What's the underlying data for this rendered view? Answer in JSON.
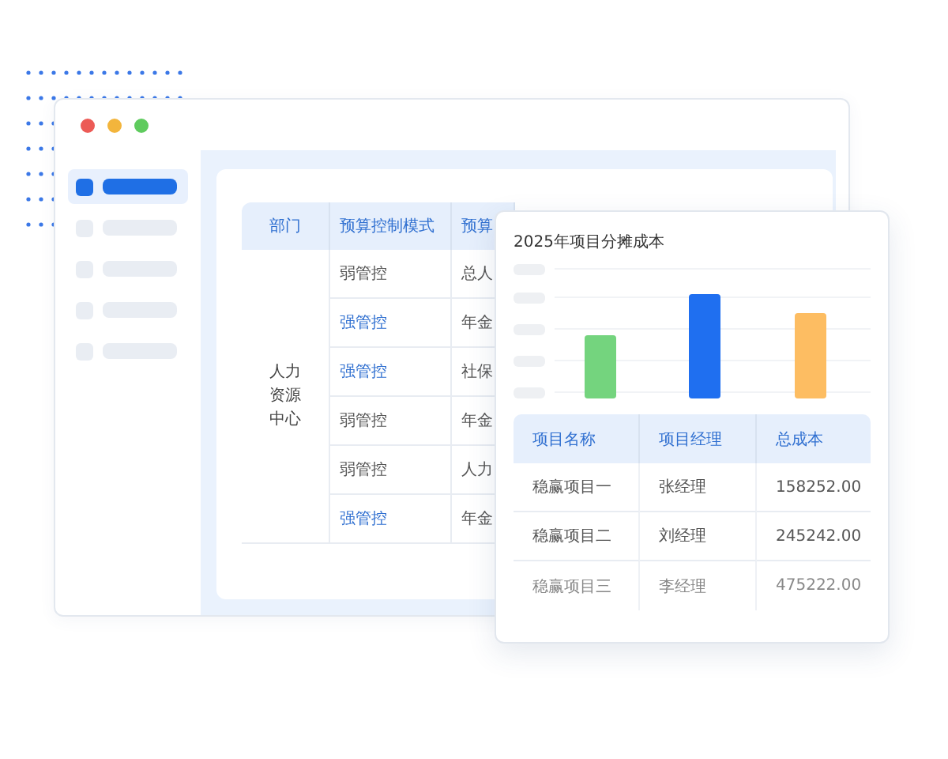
{
  "sidebar": {
    "items": [
      {
        "selected": true
      },
      {
        "selected": false
      },
      {
        "selected": false
      },
      {
        "selected": false
      },
      {
        "selected": false
      }
    ]
  },
  "budget_table": {
    "columns": [
      "部门",
      "预算控制模式",
      "预算"
    ],
    "department": "人力资源中心",
    "rows": [
      {
        "mode": "弱管控",
        "kind": "weak",
        "column_3": "总人"
      },
      {
        "mode": "强管控",
        "kind": "strong",
        "column_3": "年金"
      },
      {
        "mode": "强管控",
        "kind": "strong",
        "column_3": "社保"
      },
      {
        "mode": "弱管控",
        "kind": "weak",
        "column_3": "年金"
      },
      {
        "mode": "弱管控",
        "kind": "weak",
        "column_3": "人力"
      },
      {
        "mode": "强管控",
        "kind": "strong",
        "column_3": "年金"
      }
    ]
  },
  "cost_card": {
    "title": "2025年项目分摊成本",
    "columns": [
      "项目名称",
      "项目经理",
      "总成本"
    ],
    "rows": [
      [
        "稳赢项目一",
        "张经理",
        "158252.00"
      ],
      [
        "稳赢项目二",
        "刘经理",
        "245242.00"
      ],
      [
        "稳赢项目三",
        "李经理",
        "475222.00"
      ]
    ]
  }
}
